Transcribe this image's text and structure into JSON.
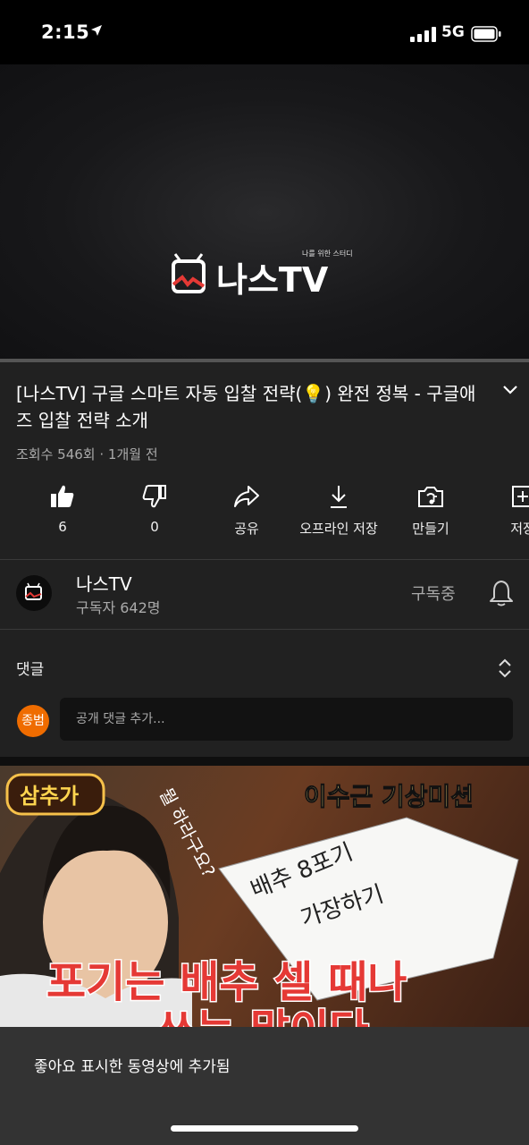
{
  "status_bar": {
    "time": "2:15",
    "network": "5G"
  },
  "player": {
    "logo_tagline": "나를 위한 스터디",
    "logo_text": "나스TV",
    "progress": 0
  },
  "video": {
    "title": "[나스TV] 구글 스마트 자동 입찰 전략(💡) 완전 정복 - 구글애즈 입찰 전략 소개",
    "meta": "조회수 546회 · 1개월 전"
  },
  "actions": [
    {
      "name": "like",
      "label": "6"
    },
    {
      "name": "dislike",
      "label": "0"
    },
    {
      "name": "share",
      "label": "공유"
    },
    {
      "name": "download",
      "label": "오프라인 저장"
    },
    {
      "name": "create",
      "label": "만들기"
    },
    {
      "name": "save",
      "label": "저장"
    }
  ],
  "channel": {
    "name": "나스TV",
    "subscribers": "구독자 642명",
    "subscribe_status": "구독중"
  },
  "comments": {
    "heading": "댓글",
    "avatar_initials": "종범",
    "placeholder": "공개 댓글 추가..."
  },
  "next_thumbnail": {
    "badge": "삼추가",
    "top_caption": "이수근 기상미션",
    "side_caption": "뭘 하라구요?",
    "note_line1": "배추 8포기",
    "note_line2": "가장하기",
    "headline_line1": "포기는 배추 셀 때나",
    "headline_line2": "쓰는 말이다"
  },
  "snackbar": {
    "message": "좋아요 표시한 동영상에 추가됨"
  },
  "colors": {
    "background": "#212121",
    "status_bar": "#000000",
    "avatar": "#ef6c00",
    "brand_red": "#e53935"
  }
}
